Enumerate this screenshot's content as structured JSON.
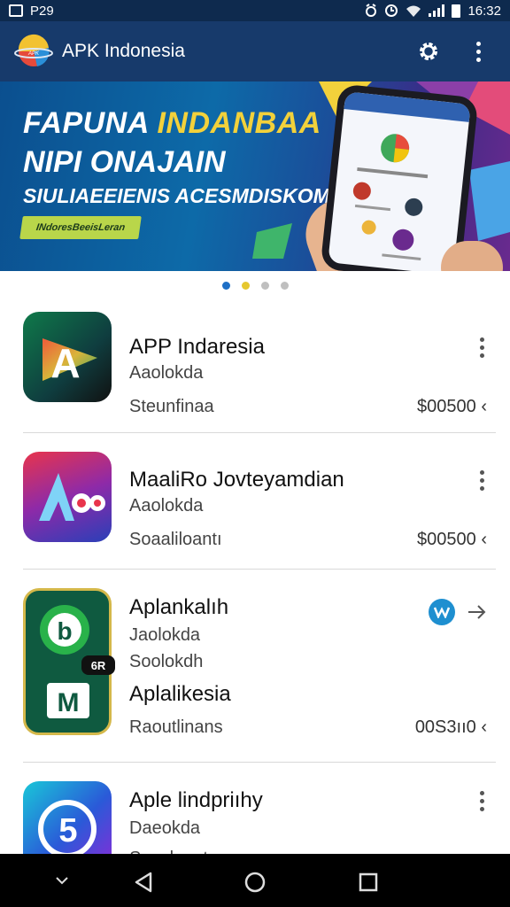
{
  "status_bar": {
    "left_text": "P29",
    "time": "16:32"
  },
  "app_bar": {
    "title": "APK Indonesia",
    "settings_icon": "gear-icon",
    "menu_icon": "kebab-icon"
  },
  "banner": {
    "line1_white": "FAPUNA ",
    "line1_yellow": "INDANBAA",
    "line2": "NIPI ONAJAIN",
    "line3": "SIULIAEEIENIS ACESMDISKOM",
    "cta": "INdoresBeeisLeran"
  },
  "carousel": {
    "count": 4,
    "active": 0,
    "colors": [
      "#1e6fc6",
      "#e6c72e",
      "#bfbfbf",
      "#bfbfbf"
    ]
  },
  "apps": [
    {
      "title": "APP Indaresia",
      "sub1": "Aaolokda",
      "sub2": "Steunfinaa",
      "price": "$00500"
    },
    {
      "title": "MaaliRo Jovteyamdian",
      "sub1": "Aaolokda",
      "sub2": "Soaaliloantı",
      "price": "$00500"
    },
    {
      "title": "Aplankalıh",
      "sub1": "Jaolokda",
      "sub2": "Soolokdh",
      "title2": "Aplalikesia",
      "sub3": "Raoutlinans",
      "price": "00S3ıı0",
      "badge": "6R"
    },
    {
      "title": "Aple lindpriıhy",
      "sub1": "Daeokda",
      "sub2": "Scaulannt"
    }
  ],
  "colors": {
    "app_bar": "#173a6b",
    "status_bar": "#0e2a4e",
    "accent": "#1e8fd0"
  }
}
